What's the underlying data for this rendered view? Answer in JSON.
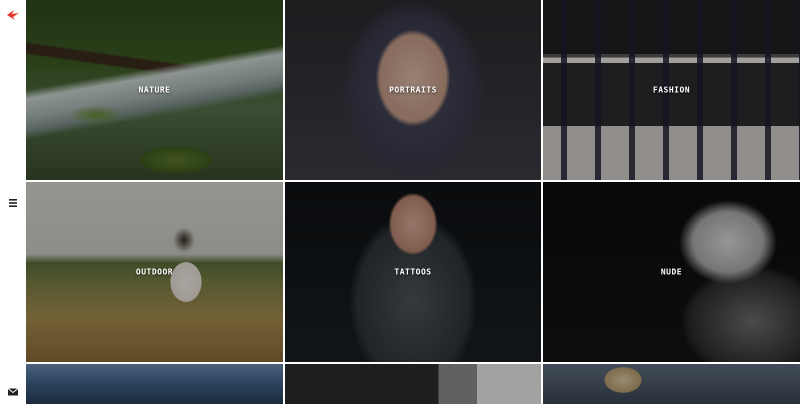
{
  "sidebar": {
    "logo_icon": "bird-logo-icon",
    "menu_icon": "hamburger-menu-icon",
    "mail_icon": "envelope-icon",
    "accent_color": "#e23b2e"
  },
  "gallery": {
    "tiles": [
      {
        "label": "NATURE"
      },
      {
        "label": "PORTRAITS"
      },
      {
        "label": "FASHION"
      },
      {
        "label": "OUTDOOR"
      },
      {
        "label": "TATTOOS"
      },
      {
        "label": "NUDE"
      },
      {
        "label": ""
      },
      {
        "label": ""
      },
      {
        "label": ""
      }
    ]
  }
}
